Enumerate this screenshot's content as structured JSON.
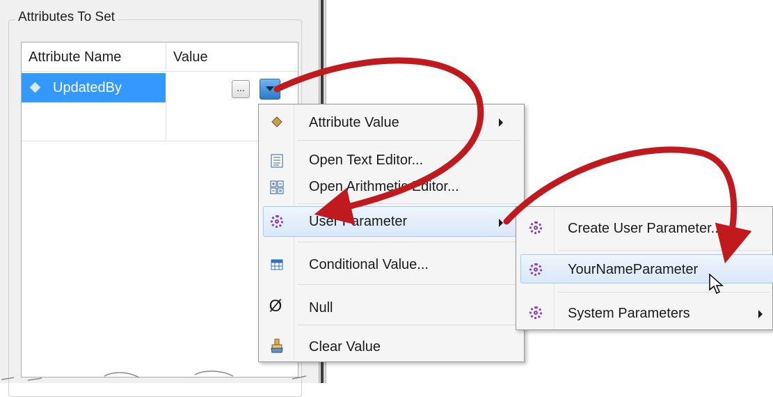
{
  "panel": {
    "group_title": "Attributes To Set",
    "columns": [
      "Attribute Name",
      "Value"
    ],
    "rows": [
      {
        "name": "UpdatedBy",
        "value": ""
      }
    ],
    "ellipsis_label": "...",
    "selected_row_color": "#3399ff"
  },
  "menu_main": {
    "items": [
      {
        "label": "Attribute Value",
        "icon": "attribute-diamond-icon",
        "has_submenu": true
      },
      {
        "label": "Open Text Editor...",
        "icon": "text-editor-icon",
        "has_submenu": false
      },
      {
        "label": "Open Arithmetic Editor...",
        "icon": "arithmetic-editor-icon",
        "has_submenu": false
      },
      {
        "label": "User Parameter",
        "icon": "gear-icon",
        "has_submenu": true,
        "highlighted": true
      },
      {
        "label": "Conditional Value...",
        "icon": "table-grid-icon",
        "has_submenu": false
      },
      {
        "label": "Null",
        "icon": "null-icon",
        "has_submenu": false
      },
      {
        "label": "Clear Value",
        "icon": "eraser-icon",
        "has_submenu": false
      }
    ],
    "null_glyph": "Ø"
  },
  "menu_sub": {
    "items": [
      {
        "label": "Create User Parameter...",
        "icon": "gear-icon",
        "has_submenu": false
      },
      {
        "label": "YourNameParameter",
        "icon": "gear-icon",
        "has_submenu": false,
        "highlighted": true
      },
      {
        "label": "System Parameters",
        "icon": "gear-icon",
        "has_submenu": true
      }
    ]
  },
  "annotation": {
    "arrow_color": "#c0191e"
  }
}
